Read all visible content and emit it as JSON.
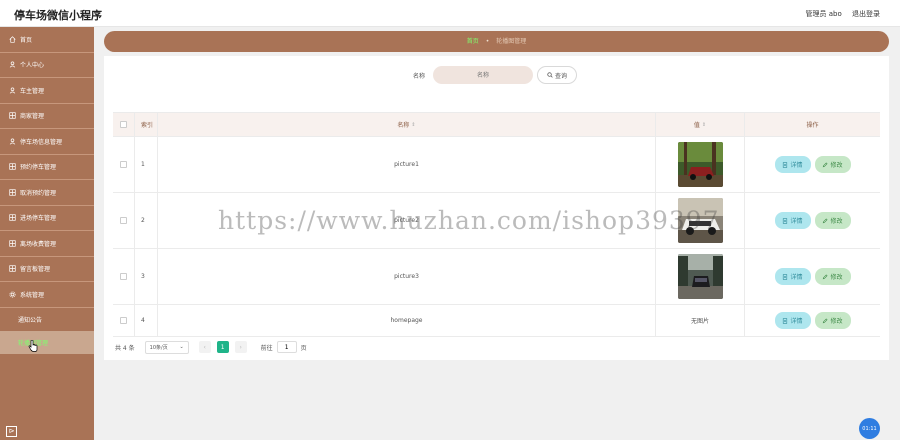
{
  "app": {
    "title": "停车场微信小程序"
  },
  "topbar": {
    "user": "管理员 abo",
    "logout": "退出登录"
  },
  "sidebar": {
    "items": [
      {
        "label": "首页",
        "icon": "home-icon"
      },
      {
        "label": "个人中心",
        "icon": "user-icon"
      },
      {
        "label": "车主管理",
        "icon": "user-icon"
      },
      {
        "label": "商家管理",
        "icon": "grid-icon"
      },
      {
        "label": "停车场信息管理",
        "icon": "user-icon"
      },
      {
        "label": "预约停车管理",
        "icon": "grid-icon"
      },
      {
        "label": "取消预约管理",
        "icon": "grid-icon"
      },
      {
        "label": "进场停车管理",
        "icon": "grid-icon"
      },
      {
        "label": "离场收费管理",
        "icon": "grid-icon"
      },
      {
        "label": "留言板管理",
        "icon": "grid-icon"
      },
      {
        "label": "系统管理",
        "icon": "gear-icon"
      }
    ],
    "subitems": [
      {
        "label": "通知公告"
      },
      {
        "label": "轮播图管理"
      }
    ],
    "toggle_glyph": "⊳"
  },
  "breadcrumb": {
    "home": "首页",
    "separator": "•",
    "current": "轮播图管理"
  },
  "search": {
    "label": "名称",
    "placeholder": "名称",
    "button": "查询"
  },
  "table": {
    "headers": {
      "index": "索引",
      "name": "名称",
      "value": "值",
      "ops": "操作"
    },
    "sort_glyph": "⇕",
    "rows": [
      {
        "index": "1",
        "name": "picture1",
        "image": "photo-forest-car",
        "no_image_text": ""
      },
      {
        "index": "2",
        "name": "picture2",
        "image": "photo-white-car",
        "no_image_text": ""
      },
      {
        "index": "3",
        "name": "picture3",
        "image": "photo-road-car",
        "no_image_text": ""
      },
      {
        "index": "4",
        "name": "homepage",
        "image": "",
        "no_image_text": "无图片"
      }
    ],
    "detail_label": "详情",
    "edit_label": "修改"
  },
  "pagination": {
    "total": "共 4 条",
    "page_size": "10条/页",
    "prev": "‹",
    "current": "1",
    "next": "›",
    "goto_prefix": "前往",
    "goto_value": "1",
    "goto_suffix": "页"
  },
  "float": {
    "clock": "01:11"
  },
  "watermark": "https://www.huzhan.com/ishop39397",
  "colors": {
    "sidebar": "#a97356",
    "accent_green": "#7fff6e",
    "page_active": "#1fb489"
  }
}
